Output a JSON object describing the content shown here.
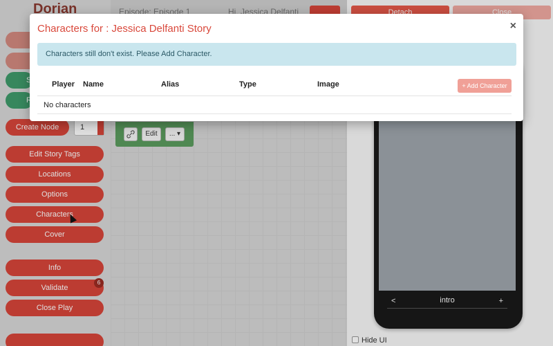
{
  "app": {
    "logo": "Dorian"
  },
  "sidebar": {
    "create_node": "Create Node",
    "node_count": "1",
    "green1": "S",
    "green2": "R",
    "items": [
      "Edit Story Tags",
      "Locations",
      "Options",
      "Characters",
      "Cover"
    ],
    "info": "Info",
    "validate": "Validate",
    "validate_badge": "6",
    "close_play": "Close Play"
  },
  "canvas": {
    "header_left": "Episode: Episode 1",
    "header_right": "Hi, Jessica Delfanti",
    "node_edit": "Edit",
    "node_more": "..."
  },
  "preview": {
    "detach": "Detach",
    "close": "Close",
    "nav_prev": "<",
    "nav_label": "intro",
    "nav_next": "+",
    "hide_ui": "Hide UI"
  },
  "modal": {
    "title": "Characters for : Jessica Delfanti Story",
    "close_symbol": "×",
    "alert": "Characters still don't exist. Please Add Character.",
    "columns": [
      "Player",
      "Name",
      "Alias",
      "Type",
      "Image"
    ],
    "add_button": "+ Add Character",
    "empty_text": "No characters"
  }
}
